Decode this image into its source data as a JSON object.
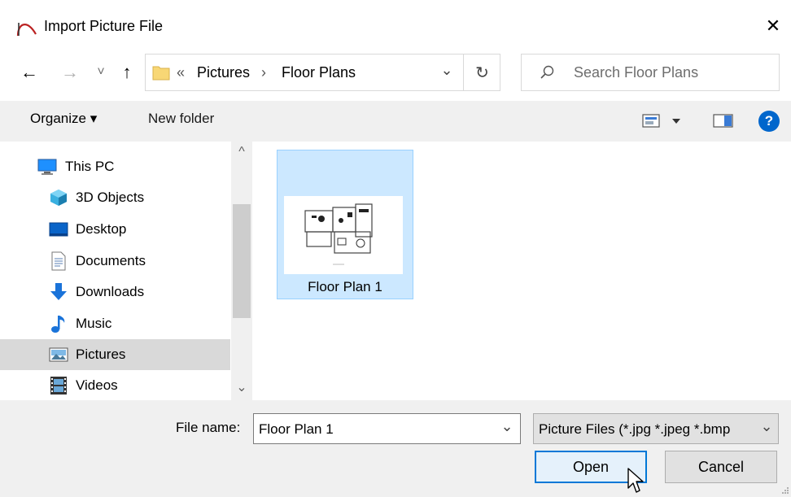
{
  "window": {
    "title": "Import Picture File",
    "close_glyph": "✕"
  },
  "nav": {
    "back_glyph": "←",
    "forward_glyph": "→",
    "recent_glyph": "˅",
    "up_glyph": "↑"
  },
  "address": {
    "overflow": "«",
    "segments": [
      "Pictures",
      "Floor Plans"
    ],
    "separator": "›",
    "dropdown_glyph": "⌄",
    "refresh_glyph": "↻"
  },
  "search": {
    "placeholder": "Search Floor Plans"
  },
  "toolbar": {
    "organize_label": "Organize ▾",
    "new_folder_label": "New folder",
    "help_glyph": "?"
  },
  "tree": {
    "items": [
      {
        "label": "This PC",
        "icon": "computer-icon"
      },
      {
        "label": "3D Objects",
        "icon": "cube-icon"
      },
      {
        "label": "Desktop",
        "icon": "desktop-icon"
      },
      {
        "label": "Documents",
        "icon": "document-icon"
      },
      {
        "label": "Downloads",
        "icon": "download-icon"
      },
      {
        "label": "Music",
        "icon": "music-note-icon"
      },
      {
        "label": "Pictures",
        "icon": "picture-icon"
      },
      {
        "label": "Videos",
        "icon": "film-icon"
      }
    ],
    "selected": "Pictures",
    "scroll_up_glyph": "^",
    "scroll_down_glyph": "⌄"
  },
  "files": [
    {
      "name": "Floor Plan 1",
      "selected": true
    }
  ],
  "bottom": {
    "file_name_label": "File name:",
    "file_name_value": "Floor Plan 1",
    "dropdown_glyph": "⌄",
    "filter_value": "Picture Files (*.jpg *.jpeg *.bmp",
    "open_label": "Open",
    "cancel_label": "Cancel"
  },
  "colors": {
    "accent": "#0078d7",
    "selection_fill": "#cce8ff",
    "selection_border": "#99d1ff",
    "help_blue": "#0066cc",
    "folder_yellow": "#f8d775"
  }
}
